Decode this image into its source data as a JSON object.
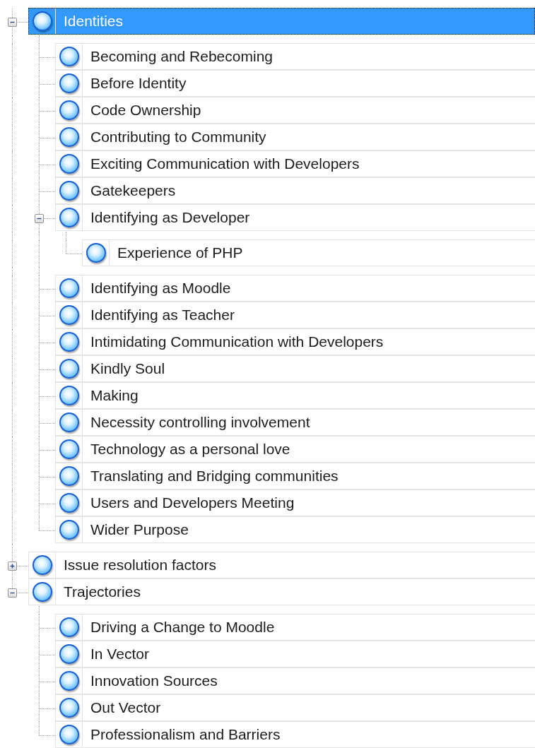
{
  "tree": [
    {
      "label": "Identities",
      "selected": true,
      "expanded": true,
      "children": [
        {
          "label": "Becoming and Rebecoming",
          "selected": false
        },
        {
          "label": "Before Identity",
          "selected": false
        },
        {
          "label": "Code Ownership",
          "selected": false
        },
        {
          "label": "Contributing to Community",
          "selected": false
        },
        {
          "label": "Exciting Communication with Developers",
          "selected": false
        },
        {
          "label": "Gatekeepers",
          "selected": false
        },
        {
          "label": "Identifying as Developer",
          "selected": false,
          "expanded": true,
          "children": [
            {
              "label": "Experience of PHP",
              "selected": false
            }
          ]
        },
        {
          "label": "Identifying as Moodle",
          "selected": false
        },
        {
          "label": "Identifying as Teacher",
          "selected": false
        },
        {
          "label": "Intimidating Communication with Developers",
          "selected": false
        },
        {
          "label": "Kindly Soul",
          "selected": false
        },
        {
          "label": "Making",
          "selected": false
        },
        {
          "label": "Necessity controlling involvement",
          "selected": false
        },
        {
          "label": "Technology as a personal love",
          "selected": false
        },
        {
          "label": "Translating and Bridging communities",
          "selected": false
        },
        {
          "label": "Users and Developers Meeting",
          "selected": false
        },
        {
          "label": "Wider Purpose",
          "selected": false
        }
      ]
    },
    {
      "label": "Issue resolution factors",
      "selected": false,
      "expanded": false
    },
    {
      "label": "Trajectories",
      "selected": false,
      "expanded": true,
      "children": [
        {
          "label": "Driving a Change to Moodle",
          "selected": false
        },
        {
          "label": "In Vector",
          "selected": false
        },
        {
          "label": "Innovation Sources",
          "selected": false
        },
        {
          "label": "Out Vector",
          "selected": false
        },
        {
          "label": "Professionalism and Barriers",
          "selected": false
        }
      ]
    }
  ]
}
